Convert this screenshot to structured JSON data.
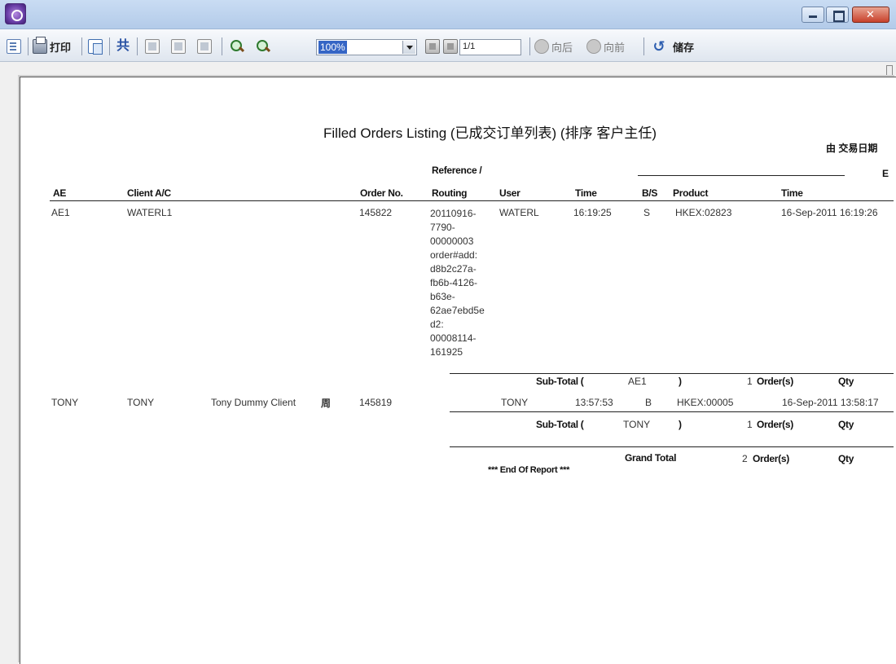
{
  "window": {
    "icon": "app-logo-icon"
  },
  "toolbar": {
    "print_label": "打印",
    "zoom_value": "100%",
    "page_value": "1/1",
    "back_label": "向后",
    "forward_label": "向前",
    "save_label": "储存",
    "share_glyph": "共"
  },
  "report": {
    "title": "Filled Orders Listing (已成交订单列表) (排序 客户主任)",
    "subtitle_right": "由 交易日期",
    "header_right_cut": "E",
    "columns": {
      "ae": "AE",
      "client_ac": "Client A/C",
      "order_no": "Order No.",
      "reference_top": "Reference /",
      "routing": "Routing",
      "user": "User",
      "time": "Time",
      "bs": "B/S",
      "product": "Product",
      "exec_time": "Time"
    },
    "rows": [
      {
        "ae": "AE1",
        "client_ac": "WATERL1",
        "client_name": "",
        "client_flag": "",
        "order_no": "145822",
        "routing": "20110916-\n7790-\n00000003\norder#add:\nd8b2c27a-\nfb6b-4126-\nb63e-\n62ae7ebd5e\nd2:\n00008114-\n161925",
        "user": "WATERL",
        "time": "16:19:25",
        "bs": "S",
        "product": "HKEX:02823",
        "exec_time": "16-Sep-2011 16:19:26"
      },
      {
        "ae": "TONY",
        "client_ac": "TONY",
        "client_name": "Tony Dummy Client",
        "client_flag": "周",
        "order_no": "145819",
        "routing": "",
        "user": "TONY",
        "time": "13:57:53",
        "bs": "B",
        "product": "HKEX:00005",
        "exec_time": "16-Sep-2011 13:58:17"
      }
    ],
    "subtotals": [
      {
        "label": "Sub-Total (",
        "key": "AE1",
        "close": ")",
        "count": "1",
        "unit": "Order(s)",
        "qty": "Qty"
      },
      {
        "label": "Sub-Total (",
        "key": "TONY",
        "close": ")",
        "count": "1",
        "unit": "Order(s)",
        "qty": "Qty"
      }
    ],
    "grand_total": {
      "label": "Grand Total",
      "count": "2",
      "unit": "Order(s)",
      "qty": "Qty"
    },
    "end_of_report": "*** End Of Report ***"
  }
}
